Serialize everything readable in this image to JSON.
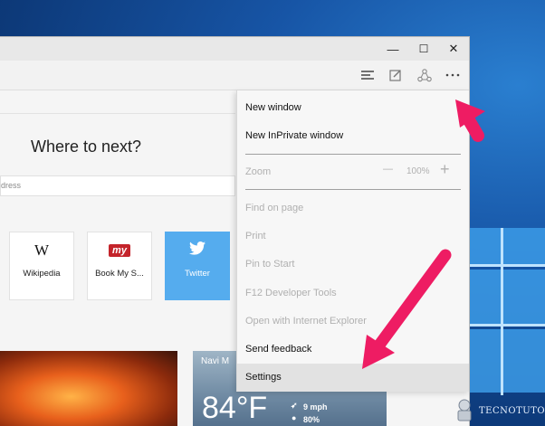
{
  "window": {
    "minimize_glyph": "—",
    "maximize_glyph": "☐",
    "close_glyph": "✕"
  },
  "new_tab": {
    "heading": "Where to next?",
    "search_placeholder": "dress",
    "tiles": [
      {
        "label": "Wikipedia",
        "logo": "W"
      },
      {
        "label": "Book My S...",
        "logo": "my"
      },
      {
        "label": "Twitter",
        "logo": "twitter-bird"
      }
    ],
    "weather": {
      "city": "Navi M",
      "temperature": "84°F",
      "wind": "9 mph",
      "humidity": "80%"
    }
  },
  "menu": {
    "items": [
      {
        "label": "New window",
        "enabled": true
      },
      {
        "label": "New InPrivate window",
        "enabled": true
      },
      {
        "label": "Zoom",
        "enabled": false
      },
      {
        "label": "Find on page",
        "enabled": false
      },
      {
        "label": "Print",
        "enabled": false
      },
      {
        "label": "Pin to Start",
        "enabled": false
      },
      {
        "label": "F12 Developer Tools",
        "enabled": false
      },
      {
        "label": "Open with Internet Explorer",
        "enabled": false
      },
      {
        "label": "Send feedback",
        "enabled": true
      },
      {
        "label": "Settings",
        "enabled": true,
        "highlighted": true
      }
    ],
    "zoom_value": "100%",
    "zoom_minus": "—",
    "zoom_plus": "+"
  },
  "watermark": {
    "text": "TECNOTUTO"
  },
  "colors": {
    "arrow": "#ee1c63",
    "twitter_tile": "#55acee",
    "bookmyshow": "#c4242b",
    "desktop": "#1755a6"
  }
}
